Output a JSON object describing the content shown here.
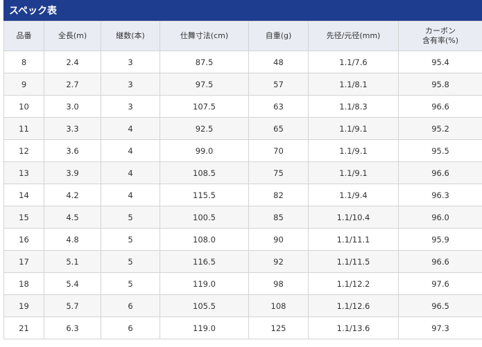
{
  "title": "スペック表",
  "headers": [
    {
      "lines": [
        "品番"
      ]
    },
    {
      "lines": [
        "全長(m)"
      ]
    },
    {
      "lines": [
        "継数(本)"
      ]
    },
    {
      "lines": [
        "仕舞寸法(cm)"
      ]
    },
    {
      "lines": [
        "自重(g)"
      ]
    },
    {
      "lines": [
        "先径/元径(mm)"
      ]
    },
    {
      "lines": [
        "カーボン",
        "含有率(%)"
      ]
    }
  ],
  "rows": [
    [
      "8",
      "2.4",
      "3",
      "87.5",
      "48",
      "1.1/7.6",
      "95.4"
    ],
    [
      "9",
      "2.7",
      "3",
      "97.5",
      "57",
      "1.1/8.1",
      "95.8"
    ],
    [
      "10",
      "3.0",
      "3",
      "107.5",
      "63",
      "1.1/8.3",
      "96.6"
    ],
    [
      "11",
      "3.3",
      "4",
      "92.5",
      "65",
      "1.1/9.1",
      "95.2"
    ],
    [
      "12",
      "3.6",
      "4",
      "99.0",
      "70",
      "1.1/9.1",
      "95.5"
    ],
    [
      "13",
      "3.9",
      "4",
      "108.5",
      "75",
      "1.1/9.1",
      "96.6"
    ],
    [
      "14",
      "4.2",
      "4",
      "115.5",
      "82",
      "1.1/9.4",
      "96.3"
    ],
    [
      "15",
      "4.5",
      "5",
      "100.5",
      "85",
      "1.1/10.4",
      "96.0"
    ],
    [
      "16",
      "4.8",
      "5",
      "108.0",
      "90",
      "1.1/11.1",
      "95.9"
    ],
    [
      "17",
      "5.1",
      "5",
      "116.5",
      "92",
      "1.1/11.5",
      "96.6"
    ],
    [
      "18",
      "5.4",
      "5",
      "119.0",
      "98",
      "1.1/12.2",
      "97.6"
    ],
    [
      "19",
      "5.7",
      "6",
      "105.5",
      "108",
      "1.1/12.6",
      "96.5"
    ],
    [
      "21",
      "6.3",
      "6",
      "119.0",
      "125",
      "1.1/13.6",
      "97.3"
    ]
  ],
  "colors": {
    "title_bg": "#1f3d8f",
    "header_bg": "#e9ecf3",
    "stripe": "#f6f6f6",
    "border": "#d3d3d3"
  }
}
